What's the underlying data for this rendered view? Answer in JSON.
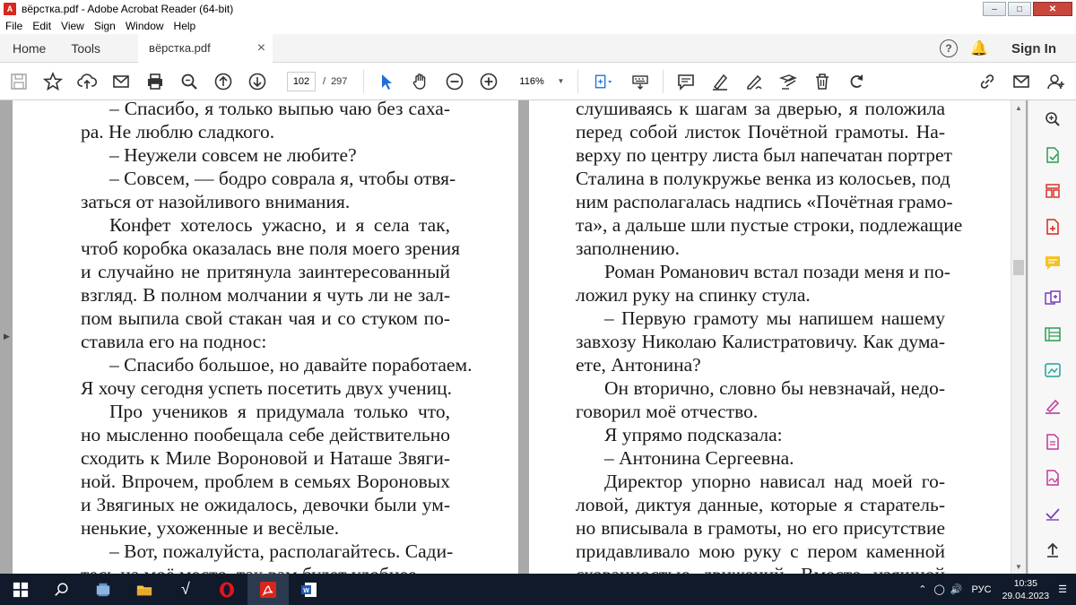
{
  "window": {
    "title": "вёрстка.pdf - Adobe Acrobat Reader (64-bit)",
    "app_icon": "acrobat-icon"
  },
  "menu": [
    "File",
    "Edit",
    "View",
    "Sign",
    "Window",
    "Help"
  ],
  "tabs": {
    "home": "Home",
    "tools": "Tools",
    "document": "вёрстка.pdf",
    "close": "×",
    "help": "?",
    "signin": "Sign In"
  },
  "toolbar": {
    "page_current": "102",
    "page_separator": "/",
    "page_total": "297",
    "zoom": "116%"
  },
  "document": {
    "left_page_lines": [
      {
        "t": "– Спасибо, я только выпью чаю без саха-",
        "i": true,
        "l": false
      },
      {
        "t": "ра. Не люблю сладкого.",
        "i": false,
        "l": true
      },
      {
        "t": "– Неужели совсем не любите?",
        "i": true,
        "l": true
      },
      {
        "t": "– Совсем, — бодро соврала я, чтобы отвя-",
        "i": true,
        "l": false
      },
      {
        "t": "заться от назойливого внимания.",
        "i": false,
        "l": true
      },
      {
        "t": "Конфет хотелось ужасно, и я села так,",
        "i": true,
        "l": false
      },
      {
        "t": "чтоб коробка оказалась вне поля моего зрения",
        "i": false,
        "l": false
      },
      {
        "t": "и случайно не притянула заинтересованный",
        "i": false,
        "l": false
      },
      {
        "t": "взгляд. В полном молчании я чуть ли не зал-",
        "i": false,
        "l": false
      },
      {
        "t": "пом выпила свой стакан чая и со стуком по-",
        "i": false,
        "l": false
      },
      {
        "t": "ставила его на поднос:",
        "i": false,
        "l": true
      },
      {
        "t": "– Спасибо большое, но давайте поработаем.",
        "i": true,
        "l": false
      },
      {
        "t": "Я хочу сегодня успеть посетить двух учениц.",
        "i": false,
        "l": true
      },
      {
        "t": "Про учеников я придумала только что,",
        "i": true,
        "l": false
      },
      {
        "t": "но мысленно пообещала себе действительно",
        "i": false,
        "l": false
      },
      {
        "t": "сходить к Миле Вороновой и Наташе Звяги-",
        "i": false,
        "l": false
      },
      {
        "t": "ной. Впрочем, проблем в семьях Вороновых",
        "i": false,
        "l": false
      },
      {
        "t": "и Звягиных не ожидалось, девочки были ум-",
        "i": false,
        "l": false
      },
      {
        "t": "ненькие, ухоженные и весёлые.",
        "i": false,
        "l": true
      },
      {
        "t": "– Вот, пожалуйста, располагайтесь. Сади-",
        "i": true,
        "l": false
      },
      {
        "t": "тесь на моё место, так вам будет удобнее.",
        "i": false,
        "l": true
      }
    ],
    "right_page_lines": [
      {
        "t": "слушиваясь к шагам за дверью, я положила",
        "i": false,
        "l": false
      },
      {
        "t": "перед собой листок Почётной грамоты. На-",
        "i": false,
        "l": false
      },
      {
        "t": "верху по центру листа был напечатан портрет",
        "i": false,
        "l": false
      },
      {
        "t": "Сталина в полукружье венка из колосьев, под",
        "i": false,
        "l": false
      },
      {
        "t": "ним располагалась надпись «Почётная грамо-",
        "i": false,
        "l": false
      },
      {
        "t": "та», а дальше шли пустые строки, подлежащие",
        "i": false,
        "l": false
      },
      {
        "t": "заполнению.",
        "i": false,
        "l": true
      },
      {
        "t": "Роман Романович встал позади меня и по-",
        "i": true,
        "l": false
      },
      {
        "t": "ложил руку на спинку стула.",
        "i": false,
        "l": true
      },
      {
        "t": "– Первую грамоту мы напишем нашему",
        "i": true,
        "l": false
      },
      {
        "t": "завхозу Николаю Калистратовичу. Как дума-",
        "i": false,
        "l": false
      },
      {
        "t": "ете, Антонина?",
        "i": false,
        "l": true
      },
      {
        "t": "Он вторично, словно бы невзначай, недо-",
        "i": true,
        "l": false
      },
      {
        "t": "говорил моё отчество.",
        "i": false,
        "l": true
      },
      {
        "t": "Я упрямо подсказала:",
        "i": true,
        "l": true
      },
      {
        "t": "– Антонина Сергеевна.",
        "i": true,
        "l": true
      },
      {
        "t": "Директор упорно нависал над моей го-",
        "i": true,
        "l": false
      },
      {
        "t": "ловой, диктуя данные, которые я старатель-",
        "i": false,
        "l": false
      },
      {
        "t": "но вписывала в грамоты, но его присутствие",
        "i": false,
        "l": false
      },
      {
        "t": "придавливало мою руку с пером каменной",
        "i": false,
        "l": false
      },
      {
        "t": "скованностью движений. Вместо изящной",
        "i": false,
        "l": false
      }
    ]
  },
  "taskbar": {
    "language": "РУС",
    "time": "10:35",
    "date": "29.04.2023"
  }
}
